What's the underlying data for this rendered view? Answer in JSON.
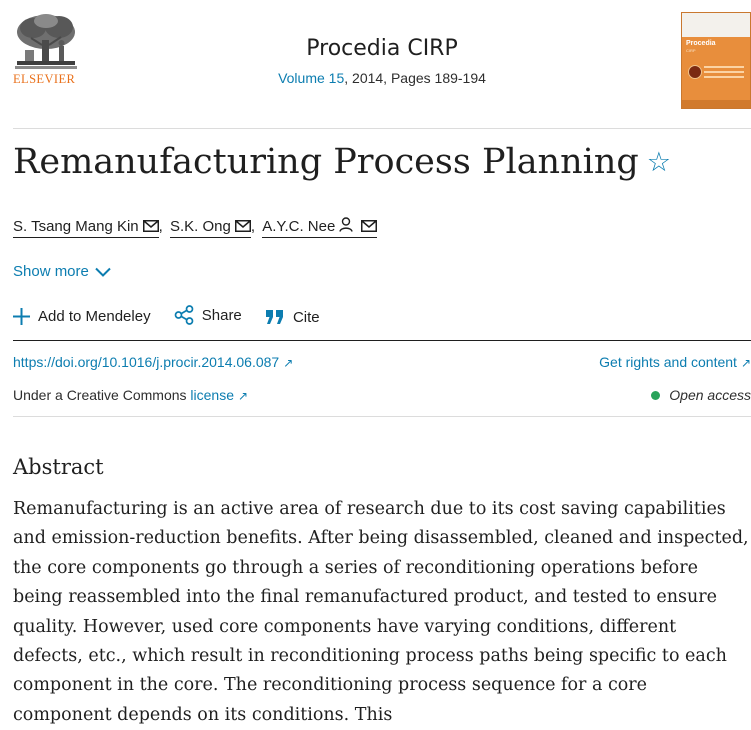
{
  "publisher": {
    "name": "ELSEVIER"
  },
  "journal": {
    "title": "Procedia CIRP",
    "volume_link": "Volume 15",
    "details": ", 2014, Pages 189-194"
  },
  "cover": {
    "name": "Procedia",
    "name2": "CIRP"
  },
  "article": {
    "title": "Remanufacturing Process Planning",
    "authors": [
      {
        "name": "S. Tsang Mang Kin",
        "icons": [
          "envelope-icon"
        ]
      },
      {
        "name": "S.K. Ong",
        "icons": [
          "envelope-icon"
        ]
      },
      {
        "name": "A.Y.C. Nee",
        "icons": [
          "person-icon",
          "envelope-icon"
        ]
      }
    ],
    "author_separator": ","
  },
  "show_more": "Show more",
  "actions": {
    "mendeley": "Add to Mendeley",
    "share": "Share",
    "cite": "Cite"
  },
  "doi": {
    "text": "https://doi.org/10.1016/j.procir.2014.06.087",
    "arrow": "↗"
  },
  "rights": {
    "text": "Get rights and content",
    "arrow": "↗"
  },
  "license": {
    "prefix": "Under a Creative Commons ",
    "link": "license",
    "arrow": "↗"
  },
  "open_access": {
    "label": "Open access",
    "dot_color": "#29a35a"
  },
  "abstract": {
    "heading": "Abstract",
    "text": "Remanufacturing is an active area of research due to its cost saving capabilities and emission-reduction benefits. After being disassembled, cleaned and inspected, the core components go through a series of reconditioning operations before being reassembled into the final remanufactured product, and tested to ensure quality. However, used core components have varying conditions, different defects, etc., which result in reconditioning process paths being specific to each component in the core. The reconditioning process sequence for a core component depends on its conditions. This"
  },
  "colors": {
    "link": "#0c7db0",
    "brand": "#e9711c",
    "text": "#1f1f1f"
  }
}
